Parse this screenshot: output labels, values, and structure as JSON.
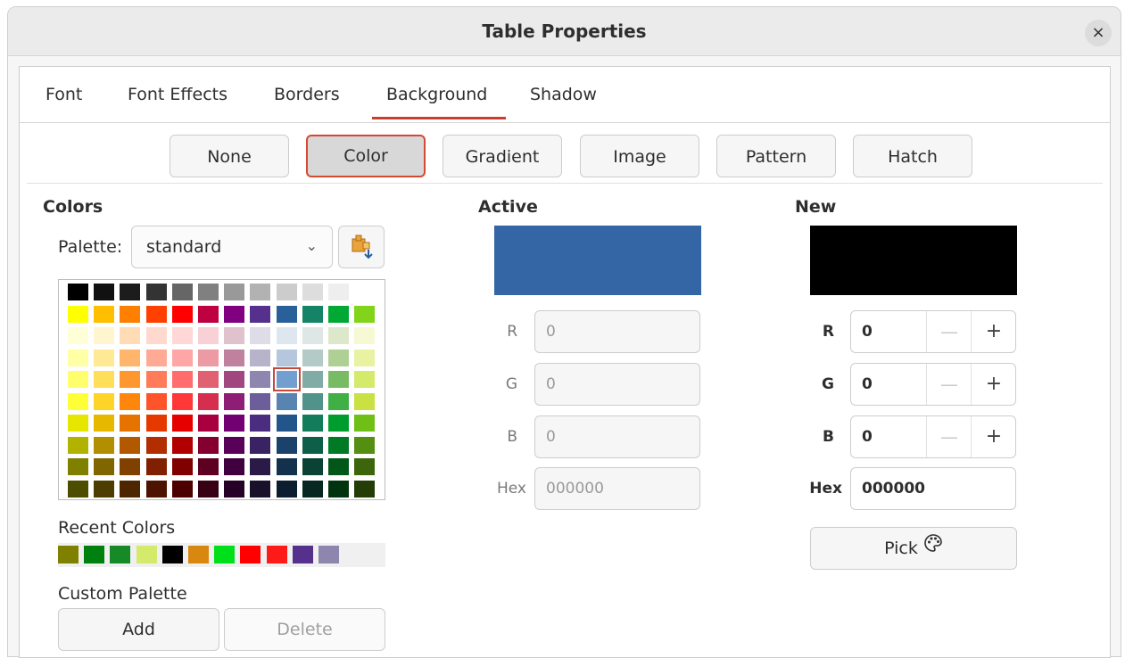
{
  "window": {
    "title": "Table Properties",
    "close_glyph": "×"
  },
  "tabs": [
    {
      "label": "Font"
    },
    {
      "label": "Font Effects"
    },
    {
      "label": "Borders"
    },
    {
      "label": "Background",
      "selected": true
    },
    {
      "label": "Shadow"
    }
  ],
  "fill_types": [
    {
      "label": "None"
    },
    {
      "label": "Color",
      "selected": true
    },
    {
      "label": "Gradient"
    },
    {
      "label": "Image"
    },
    {
      "label": "Pattern"
    },
    {
      "label": "Hatch"
    }
  ],
  "colors": {
    "heading": "Colors",
    "palette_label": "Palette:",
    "palette_value": "standard",
    "palette_options_icon": "palette-add-icon",
    "swatch_rows": [
      [
        "#000000",
        "#111111",
        "#1c1c1c",
        "#333333",
        "#666666",
        "#808080",
        "#999999",
        "#b2b2b2",
        "#cccccc",
        "#dddddd",
        "#eeeeee",
        "#ffffff"
      ],
      [
        "#ffff00",
        "#ffbf00",
        "#ff8000",
        "#ff4000",
        "#ff0000",
        "#bf0041",
        "#800080",
        "#55308d",
        "#2a6099",
        "#158466",
        "#00a933",
        "#81d41a"
      ],
      [
        "#ffffd7",
        "#fff5ce",
        "#ffdbb6",
        "#ffd8ce",
        "#ffd7d7",
        "#f7d1d5",
        "#e0c2cd",
        "#dedce6",
        "#dee6ef",
        "#dee7e5",
        "#dde8cb",
        "#f6f9d4"
      ],
      [
        "#ffffa6",
        "#ffe994",
        "#ffb66c",
        "#ffaa95",
        "#ffa6a6",
        "#ec9ba4",
        "#bf819e",
        "#b7b3ca",
        "#b4c7dc",
        "#b3cac7",
        "#afd095",
        "#e8f2a1"
      ],
      [
        "#ffff6d",
        "#ffde59",
        "#ff972f",
        "#ff7b59",
        "#ff6d6d",
        "#e16173",
        "#a1467e",
        "#8e86ae",
        "#729fcf",
        "#81aca6",
        "#77bc65",
        "#d4ea6b"
      ],
      [
        "#ffff38",
        "#ffd428",
        "#ff860d",
        "#ff5429",
        "#ff3838",
        "#d62e4e",
        "#8d1d75",
        "#6b5e9b",
        "#5983b0",
        "#50938a",
        "#3faf46",
        "#c9e143"
      ],
      [
        "#e6e600",
        "#e6b800",
        "#e67300",
        "#e63900",
        "#e60000",
        "#a8003e",
        "#730073",
        "#4b2d80",
        "#22558a",
        "#127c5b",
        "#009c2e",
        "#6fbf17"
      ],
      [
        "#b2b200",
        "#b28f00",
        "#b25900",
        "#b22d00",
        "#b20000",
        "#83002f",
        "#590059",
        "#3a2363",
        "#1a426b",
        "#0e5f48",
        "#007a24",
        "#558f12"
      ],
      [
        "#808000",
        "#806600",
        "#804000",
        "#802000",
        "#800000",
        "#5e0021",
        "#400040",
        "#2a1a47",
        "#13304c",
        "#0a4335",
        "#005717",
        "#3d660c"
      ],
      [
        "#4d4d00",
        "#4d3d00",
        "#4d2600",
        "#4d1300",
        "#4d0000",
        "#380014",
        "#260026",
        "#19102b",
        "#0b1d2e",
        "#062820",
        "#00340e",
        "#243d07"
      ]
    ],
    "selected_swatch": [
      4,
      8
    ],
    "recent_label": "Recent Colors",
    "recent": [
      "#808000",
      "#00800f",
      "#158a26",
      "#d4ea6b",
      "#000000",
      "#d9880f",
      "#00e01a",
      "#ff0000",
      "#ff1a1a",
      "#55308d",
      "#8e86ae"
    ],
    "custom_label": "Custom Palette",
    "add_label": "Add",
    "delete_label": "Delete"
  },
  "active": {
    "heading": "Active",
    "color": "#3465a4",
    "r_label": "R",
    "r": "0",
    "g_label": "G",
    "g": "0",
    "b_label": "B",
    "b": "0",
    "hex_label": "Hex",
    "hex": "000000"
  },
  "new": {
    "heading": "New",
    "color": "#000000",
    "r_label": "R",
    "r": "0",
    "g_label": "G",
    "g": "0",
    "b_label": "B",
    "b": "0",
    "hex_label": "Hex",
    "hex": "000000",
    "minus_glyph": "—",
    "plus_glyph": "+",
    "pick_label": "Pick",
    "pick_icon": "color-picker-palette-icon"
  }
}
